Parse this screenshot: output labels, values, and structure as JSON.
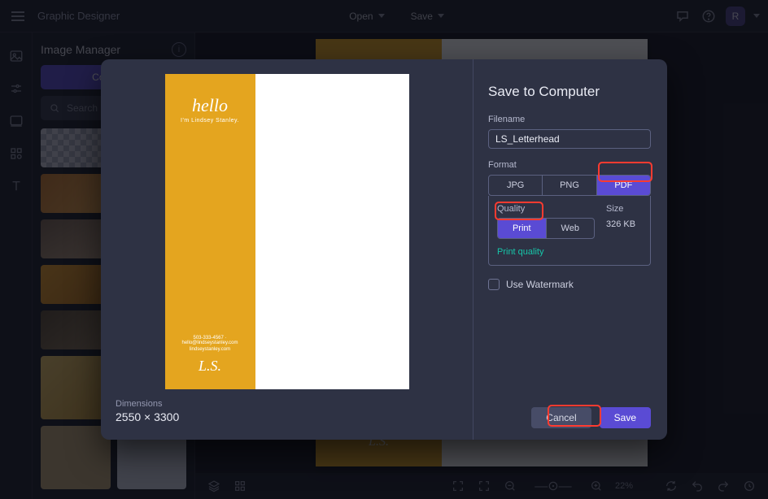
{
  "app": {
    "title": "Graphic Designer"
  },
  "topbar": {
    "open_label": "Open",
    "save_label": "Save",
    "avatar": "R"
  },
  "image_manager": {
    "title": "Image Manager",
    "button_label": "Computer",
    "search_placeholder": "Search"
  },
  "status": {
    "zoom": "22%"
  },
  "preview_doc": {
    "hello": "hello",
    "subtitle": "I'm Lindsey Stanley.",
    "contact1": "503-333-4567 · hello@lindseystanley.com",
    "contact2": "lindseystanley.com",
    "monogram": "L.S."
  },
  "modal": {
    "title": "Save to Computer",
    "dimensions_label": "Dimensions",
    "dimensions_value": "2550 × 3300",
    "filename_label": "Filename",
    "filename_value": "LS_Letterhead",
    "format_label": "Format",
    "format_options": {
      "jpg": "JPG",
      "png": "PNG",
      "pdf": "PDF"
    },
    "quality_label": "Quality",
    "quality_options": {
      "print": "Print",
      "web": "Web"
    },
    "size_label": "Size",
    "size_value": "326 KB",
    "quality_note": "Print quality",
    "watermark_label": "Use Watermark",
    "cancel": "Cancel",
    "save": "Save"
  }
}
